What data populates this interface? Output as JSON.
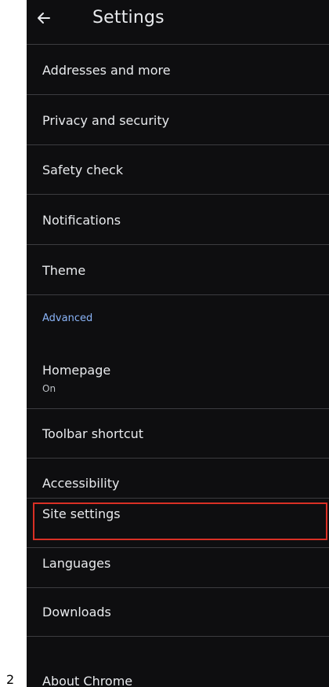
{
  "appbar": {
    "title": "Settings",
    "back_icon": "arrow-left-icon"
  },
  "settings_items": [
    {
      "label": "Addresses and more"
    },
    {
      "label": "Privacy and security"
    },
    {
      "label": "Safety check"
    },
    {
      "label": "Notifications"
    },
    {
      "label": "Theme"
    }
  ],
  "advanced_header": "Advanced",
  "advanced_items": [
    {
      "label": "Homepage",
      "sub": "On"
    },
    {
      "label": "Toolbar shortcut"
    },
    {
      "label": "Accessibility"
    },
    {
      "label": "Site settings",
      "highlighted": true
    },
    {
      "label": "Languages"
    },
    {
      "label": "Downloads"
    },
    {
      "label": "About Chrome"
    }
  ],
  "highlight_color": "#d93025",
  "page_number": "2"
}
